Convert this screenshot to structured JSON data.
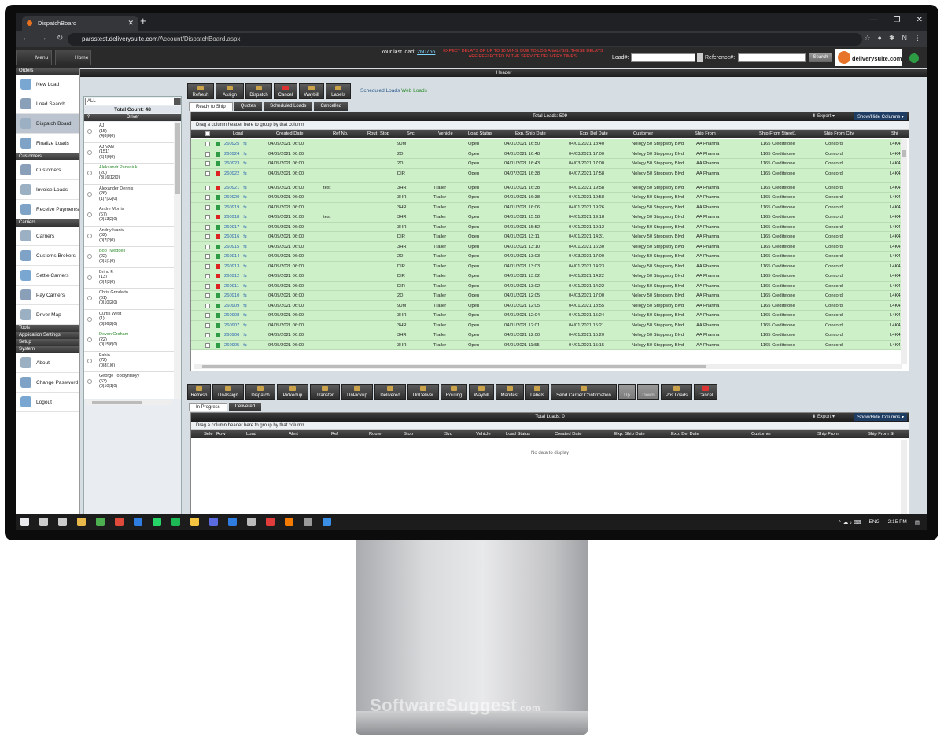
{
  "browser": {
    "tab_title": "DispatchBoard",
    "url_host": "parsstest.deliverysuite.com",
    "url_path": "/Account/DispatchBoard.aspx",
    "profile_initial": "N"
  },
  "topbar": {
    "menu_label": "Menu",
    "home_label": "Home",
    "last_load_label": "Your last load:",
    "last_load_value": "260766",
    "notice": "EXPECT DELAYS OF UP TO 10 MINS. DUE TO LOG ANALYSIS. THESE DELAYS ARE REFLECTED IN THE SERVICE DELIVERY TIMES.",
    "load_label": "Load#:",
    "reference_label": "Reference#:",
    "search_label": "Search",
    "logo_text": "deliverysuite.com"
  },
  "header_strip": "Header",
  "leftnav": {
    "sections": [
      {
        "title": "Orders",
        "items": [
          "New Load",
          "Load Search",
          "Dispatch Board",
          "Finalize Loads"
        ]
      },
      {
        "title": "Customers",
        "items": [
          "Customers",
          "Invoice Loads",
          "Receive Payments"
        ]
      },
      {
        "title": "Carriers",
        "items": [
          "Carriers",
          "Customs Brokers",
          "Settle Carriers",
          "Pay Carriers",
          "Driver Map"
        ]
      },
      {
        "title": "Tools",
        "items": []
      },
      {
        "title": "Application Settings",
        "items": []
      },
      {
        "title": "Setup",
        "items": []
      },
      {
        "title": "System",
        "items": [
          "About",
          "Change Password",
          "Logout"
        ]
      }
    ],
    "active": "Dispatch Board"
  },
  "drivers": {
    "filter_value": "ALL",
    "total_count": "Total Count: 48",
    "col_q": "?",
    "col_driver": "Driver",
    "list": [
      {
        "name": "AJ",
        "l1": "(15)",
        "l2": "(4|8|0|0)",
        "green": false
      },
      {
        "name": "AJ VAN",
        "l1": "(151)",
        "l2": "(6|4|0|0)",
        "green": false
      },
      {
        "name": "Aleksandr Panasiuk",
        "l1": "(20)",
        "l2": "(3|16|12|0)",
        "green": true
      },
      {
        "name": "Alexander Dennis",
        "l1": "(26)",
        "l2": "(1|7|32|0)",
        "green": false
      },
      {
        "name": "Andre Morris",
        "l1": "(67)",
        "l2": "(0|13|2|0)",
        "green": false
      },
      {
        "name": "Andriy Ivaniv",
        "l1": "(62)",
        "l2": "(0|7|2|0)",
        "green": false
      },
      {
        "name": "Bob Tweddell",
        "l1": "(22)",
        "l2": "(0|1|1|0)",
        "green": true
      },
      {
        "name": "Brino F.",
        "l1": "(13)",
        "l2": "(0|4|3|0)",
        "green": false
      },
      {
        "name": "Chris Grindatto",
        "l1": "(61)",
        "l2": "(0|10|2|0)",
        "green": false
      },
      {
        "name": "Curtis West",
        "l1": "(1)",
        "l2": "(3|36|2|0)",
        "green": false
      },
      {
        "name": "Devon Graham",
        "l1": "(22)",
        "l2": "(0|15|6|0)",
        "green": true
      },
      {
        "name": "Fabio",
        "l1": "(72)",
        "l2": "(0|8|1|0)",
        "green": false
      },
      {
        "name": "George Topolyntskyy",
        "l1": "(63)",
        "l2": "(0|10|1|0)",
        "green": false
      }
    ]
  },
  "toolbar1": [
    "Refresh",
    "Assign",
    "Dispatch",
    "Cancel",
    "Waybill",
    "Labels"
  ],
  "links": {
    "scheduled": "Scheduled Loads",
    "web": "Web Loads"
  },
  "tabs1": [
    "Ready to Ship",
    "Quotes",
    "Scheduled Loads",
    "Cancelled"
  ],
  "grid1": {
    "title": "Total Loads: 509",
    "export": "Export",
    "show_hide": "Show/Hide Columns",
    "drag_hint": "Drag a column header here to group by that column",
    "columns": [
      "Load",
      "Created Date",
      "Ref No.",
      "Rout",
      "Stop",
      "Svc",
      "Vehicle",
      "Load Status",
      "Exp. Ship Date",
      "Exp. Del Date",
      "Customer",
      "Ship From",
      "Ship From Street1",
      "Ship From City",
      "Shi"
    ],
    "rows": [
      {
        "load": "260925",
        "created": "04/05/2021 06:00",
        "ref": "",
        "svc": "90M",
        "veh": "",
        "status": "Open",
        "ship": "04/01/2021 16:50",
        "del": "04/01/2021 18:40",
        "cust": "Nology 50 Steppwpy Blvd",
        "from": "AA Pharma",
        "street": "1165 Creditstone",
        "city": "Concord",
        "zip": "L4K4",
        "c": "#2e9b45"
      },
      {
        "load": "260924",
        "created": "04/05/2021 06:00",
        "ref": "",
        "svc": "2D",
        "veh": "",
        "status": "Open",
        "ship": "04/01/2021 16:48",
        "del": "04/03/2021 17:00",
        "cust": "Nology 50 Steppwpy Blvd",
        "from": "AA Pharma",
        "street": "1165 Creditstone",
        "city": "Concord",
        "zip": "L4K4",
        "c": "#2e9b45"
      },
      {
        "load": "260923",
        "created": "04/05/2021 06:00",
        "ref": "",
        "svc": "2D",
        "veh": "",
        "status": "Open",
        "ship": "04/01/2021 16:43",
        "del": "04/03/2021 17:00",
        "cust": "Nology 50 Steppwpy Blvd",
        "from": "AA Pharma",
        "street": "1165 Creditstone",
        "city": "Concord",
        "zip": "L4K4",
        "c": "#2e9b45"
      },
      {
        "load": "260922",
        "created": "04/05/2021 06:00",
        "ref": "",
        "svc": "DIR",
        "veh": "",
        "status": "Open",
        "ship": "04/07/2021 16:38",
        "del": "04/07/2021 17:58",
        "cust": "Nology 50 Steppwpy Blvd",
        "from": "AA Pharma",
        "street": "1165 Creditstone",
        "city": "Concord",
        "zip": "L4K4",
        "c": "#d22"
      },
      {
        "load": "260921",
        "created": "04/05/2021 06:00",
        "ref": "test",
        "svc": "3HR",
        "veh": "Trailer",
        "status": "Open",
        "ship": "04/01/2021 16:38",
        "del": "04/01/2021 19:58",
        "cust": "Nology 50 Steppwpy Blvd",
        "from": "AA Pharma",
        "street": "1165 Creditstone",
        "city": "Concord",
        "zip": "L4K4",
        "c": "#d22"
      },
      {
        "load": "260920",
        "created": "04/05/2021 06:00",
        "ref": "",
        "svc": "3HR",
        "veh": "Trailer",
        "status": "Open",
        "ship": "04/01/2021 16:38",
        "del": "04/01/2021 19:58",
        "cust": "Nology 50 Steppwpy Blvd",
        "from": "AA Pharma",
        "street": "1165 Creditstone",
        "city": "Concord",
        "zip": "L4K4",
        "c": "#2e9b45"
      },
      {
        "load": "260919",
        "created": "04/05/2021 06:00",
        "ref": "",
        "svc": "3HR",
        "veh": "Trailer",
        "status": "Open",
        "ship": "04/01/2021 16:06",
        "del": "04/01/2021 19:26",
        "cust": "Nology 50 Steppwpy Blvd",
        "from": "AA Pharma",
        "street": "1165 Creditstone",
        "city": "Concord",
        "zip": "L4K4",
        "c": "#2e9b45"
      },
      {
        "load": "260918",
        "created": "04/05/2021 06:00",
        "ref": "test",
        "svc": "3HR",
        "veh": "Trailer",
        "status": "Open",
        "ship": "04/01/2021 15:58",
        "del": "04/01/2021 19:18",
        "cust": "Nology 50 Steppwpy Blvd",
        "from": "AA Pharma",
        "street": "1165 Creditstone",
        "city": "Concord",
        "zip": "L4K4",
        "c": "#d22"
      },
      {
        "load": "260917",
        "created": "04/05/2021 06:00",
        "ref": "",
        "svc": "3HR",
        "veh": "Trailer",
        "status": "Open",
        "ship": "04/01/2021 15:52",
        "del": "04/01/2021 19:12",
        "cust": "Nology 50 Steppwpy Blvd",
        "from": "AA Pharma",
        "street": "1165 Creditstone",
        "city": "Concord",
        "zip": "L4K4",
        "c": "#2e9b45"
      },
      {
        "load": "260916",
        "created": "04/05/2021 06:00",
        "ref": "",
        "svc": "DIR",
        "veh": "Trailer",
        "status": "Open",
        "ship": "04/01/2021 13:11",
        "del": "04/01/2021 14:31",
        "cust": "Nology 50 Steppwpy Blvd",
        "from": "AA Pharma",
        "street": "1165 Creditstone",
        "city": "Concord",
        "zip": "L4K4",
        "c": "#d22"
      },
      {
        "load": "260915",
        "created": "04/05/2021 06:00",
        "ref": "",
        "svc": "3HR",
        "veh": "Trailer",
        "status": "Open",
        "ship": "04/01/2021 13:10",
        "del": "04/01/2021 16:30",
        "cust": "Nology 50 Steppwpy Blvd",
        "from": "AA Pharma",
        "street": "1165 Creditstone",
        "city": "Concord",
        "zip": "L4K4",
        "c": "#2e9b45"
      },
      {
        "load": "260914",
        "created": "04/05/2021 06:00",
        "ref": "",
        "svc": "2D",
        "veh": "Trailer",
        "status": "Open",
        "ship": "04/01/2021 13:03",
        "del": "04/03/2021 17:00",
        "cust": "Nology 50 Steppwpy Blvd",
        "from": "AA Pharma",
        "street": "1165 Creditstone",
        "city": "Concord",
        "zip": "L4K4",
        "c": "#2e9b45"
      },
      {
        "load": "260913",
        "created": "04/05/2021 06:00",
        "ref": "",
        "svc": "DIR",
        "veh": "Trailer",
        "status": "Open",
        "ship": "04/01/2021 13:03",
        "del": "04/01/2021 14:23",
        "cust": "Nology 50 Steppwpy Blvd",
        "from": "AA Pharma",
        "street": "1165 Creditstone",
        "city": "Concord",
        "zip": "L4K4",
        "c": "#d22"
      },
      {
        "load": "260912",
        "created": "04/05/2021 06:00",
        "ref": "",
        "svc": "DIR",
        "veh": "Trailer",
        "status": "Open",
        "ship": "04/01/2021 13:02",
        "del": "04/01/2021 14:22",
        "cust": "Nology 50 Steppwpy Blvd",
        "from": "AA Pharma",
        "street": "1165 Creditstone",
        "city": "Concord",
        "zip": "L4K4",
        "c": "#d22"
      },
      {
        "load": "260911",
        "created": "04/05/2021 06:00",
        "ref": "",
        "svc": "DIR",
        "veh": "Trailer",
        "status": "Open",
        "ship": "04/01/2021 13:02",
        "del": "04/01/2021 14:22",
        "cust": "Nology 50 Steppwpy Blvd",
        "from": "AA Pharma",
        "street": "1165 Creditstone",
        "city": "Concord",
        "zip": "L4K4",
        "c": "#d22"
      },
      {
        "load": "260910",
        "created": "04/05/2021 06:00",
        "ref": "",
        "svc": "2D",
        "veh": "Trailer",
        "status": "Open",
        "ship": "04/01/2021 12:05",
        "del": "04/03/2021 17:00",
        "cust": "Nology 50 Steppwpy Blvd",
        "from": "AA Pharma",
        "street": "1165 Creditstone",
        "city": "Concord",
        "zip": "L4K4",
        "c": "#2e9b45"
      },
      {
        "load": "260909",
        "created": "04/05/2021 06:00",
        "ref": "",
        "svc": "90M",
        "veh": "Trailer",
        "status": "Open",
        "ship": "04/01/2021 12:05",
        "del": "04/01/2021 13:55",
        "cust": "Nology 50 Steppwpy Blvd",
        "from": "AA Pharma",
        "street": "1165 Creditstone",
        "city": "Concord",
        "zip": "L4K4",
        "c": "#2e9b45"
      },
      {
        "load": "260908",
        "created": "04/05/2021 06:00",
        "ref": "",
        "svc": "3HR",
        "veh": "Trailer",
        "status": "Open",
        "ship": "04/01/2021 12:04",
        "del": "04/01/2021 15:24",
        "cust": "Nology 50 Steppwpy Blvd",
        "from": "AA Pharma",
        "street": "1165 Creditstone",
        "city": "Concord",
        "zip": "L4K4",
        "c": "#2e9b45"
      },
      {
        "load": "260907",
        "created": "04/05/2021 06:00",
        "ref": "",
        "svc": "3HR",
        "veh": "Trailer",
        "status": "Open",
        "ship": "04/01/2021 12:01",
        "del": "04/01/2021 15:21",
        "cust": "Nology 50 Steppwpy Blvd",
        "from": "AA Pharma",
        "street": "1165 Creditstone",
        "city": "Concord",
        "zip": "L4K4",
        "c": "#2e9b45"
      },
      {
        "load": "260906",
        "created": "04/05/2021 06:00",
        "ref": "",
        "svc": "3HR",
        "veh": "Trailer",
        "status": "Open",
        "ship": "04/01/2021 12:00",
        "del": "04/01/2021 15:20",
        "cust": "Nology 50 Steppwpy Blvd",
        "from": "AA Pharma",
        "street": "1165 Creditstone",
        "city": "Concord",
        "zip": "L4K4",
        "c": "#2e9b45"
      },
      {
        "load": "260905",
        "created": "04/05/2021 06:00",
        "ref": "",
        "svc": "3HR",
        "veh": "Trailer",
        "status": "Open",
        "ship": "04/01/2021 11:55",
        "del": "04/01/2021 15:15",
        "cust": "Nology 50 Steppwpy Blvd",
        "from": "AA Pharma",
        "street": "1165 Creditstone",
        "city": "Concord",
        "zip": "L4K4",
        "c": "#2e9b45"
      }
    ]
  },
  "toolbar2": [
    "Refresh",
    "UnAssign",
    "Dispatch",
    "Pickedup",
    "Transfer",
    "UnPickup",
    "Delivered",
    "UnDeliver",
    "Routing",
    "Waybill",
    "Manifest",
    "Labels",
    "Send Carrier Confirmation",
    "Up",
    "Down",
    "Pos Loads",
    "Cancel"
  ],
  "tabs2": [
    "In Progress",
    "Delivered"
  ],
  "grid2": {
    "title": "Total Loads: 0",
    "export": "Export",
    "show_hide": "Show/Hide Columns",
    "drag_hint": "Drag a column header here to group by that column",
    "columns": [
      "Sele",
      "Row",
      "Load",
      "Alert",
      "Ref",
      "Route",
      "Stop",
      "Svc",
      "Vehicle",
      "Load Status",
      "Created Date",
      "Exp. Ship Date",
      "Exp. Del Date",
      "Customer",
      "Ship From",
      "Ship From St"
    ],
    "empty": "No data to display"
  },
  "taskbar": {
    "lang": "ENG",
    "time": "2:15 PM"
  },
  "watermark": {
    "main": "SoftwareSuggest",
    "suffix": ".com"
  },
  "colors": {
    "row_green": "#cdf0c8",
    "accent_blue": "#1f3d63",
    "status_red": "#d22",
    "status_green": "#2e9b45"
  }
}
